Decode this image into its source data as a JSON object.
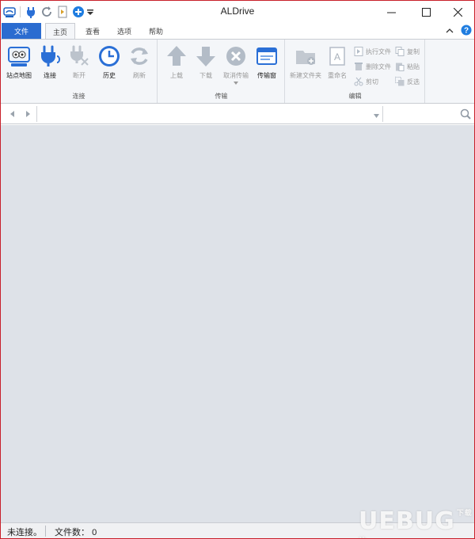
{
  "window": {
    "title": "ALDrive"
  },
  "quick_access": {
    "icons": [
      "app-logo-icon",
      "connect-icon",
      "refresh-icon",
      "document-icon",
      "add-icon",
      "dropdown-icon"
    ]
  },
  "tabs": {
    "file": "文件",
    "home": "主页",
    "view": "查看",
    "options": "选项",
    "help": "帮助"
  },
  "ribbon": {
    "connection": {
      "label": "连接",
      "site_map": "站点地图",
      "connect": "连接",
      "disconnect": "断开",
      "history": "历史",
      "refresh": "刷新"
    },
    "transfer": {
      "label": "传输",
      "upload": "上载",
      "download": "下载",
      "cancel": "取消传输",
      "window": "传输窗"
    },
    "edit": {
      "label": "编辑",
      "new_folder": "新建文件夹",
      "rename": "重命名",
      "execute": "执行文件",
      "delete": "删除文件",
      "cut": "剪切",
      "copy": "复制",
      "paste": "粘贴",
      "invert": "反选"
    }
  },
  "address": {
    "path": "",
    "search": ""
  },
  "status": {
    "connection": "未连接。",
    "file_count_label": "文件数：",
    "file_count": "0"
  },
  "watermark": {
    "text": "UEBUG",
    "suffix": "下载站"
  },
  "colors": {
    "accent": "#2b6cd0",
    "border": "#c8202a",
    "main_bg": "#dee2e8",
    "ribbon_bg": "#f4f6f9"
  }
}
